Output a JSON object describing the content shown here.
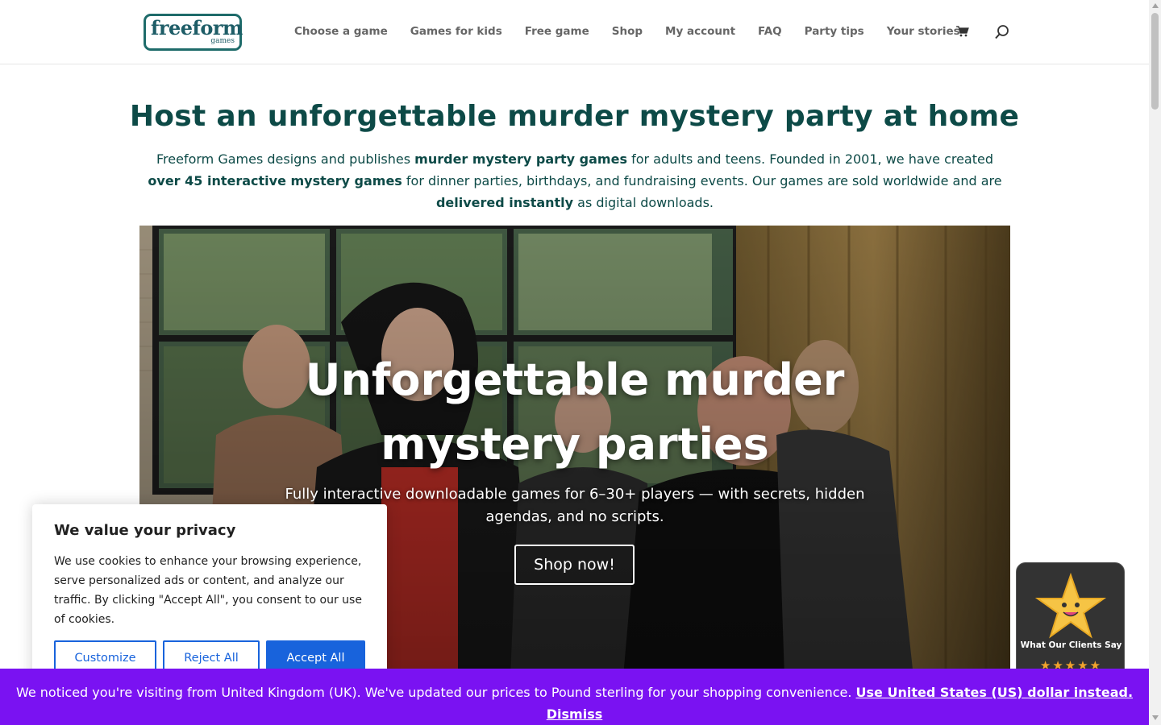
{
  "header": {
    "logo_main": "freeform",
    "logo_sub": "games",
    "nav": [
      "Choose a game",
      "Games for kids",
      "Free game",
      "Shop",
      "My account",
      "FAQ",
      "Party tips",
      "Your stories"
    ],
    "cart_icon": "shopping-cart-icon",
    "search_icon": "search-icon"
  },
  "intro": {
    "title": "Host an unforgettable murder mystery party at home",
    "p1": "Freeform Games designs and publishes ",
    "b1": "murder mystery party games",
    "p2": " for adults and teens. Founded in 2001, we have created ",
    "b2": "over 45 interactive mystery games",
    "p3": " for dinner parties, birthdays, and fundraising events. Our games are sold worldwide and are ",
    "b3": "delivered instantly",
    "p4": " as digital downloads."
  },
  "hero": {
    "title": "Unforgettable murder mystery parties",
    "subtitle": "Fully interactive downloadable games for 6–30+ players — with secrets, hidden agendas, and no scripts.",
    "button": "Shop now!"
  },
  "cookie": {
    "title": "We value your privacy",
    "text": "We use cookies to enhance your browsing experience, serve personalized ads or content, and analyze our traffic. By clicking \"Accept All\", you consent to our use of cookies.",
    "customize": "Customize",
    "reject": "Reject All",
    "accept": "Accept All"
  },
  "reviews": {
    "label": "What Our Clients Say",
    "stars": "★★★★★",
    "rating": 4.5,
    "icon": "smiling-star-icon"
  },
  "currency_bar": {
    "text": "We noticed you're visiting from United Kingdom (UK). We've updated our prices to Pound sterling for your shopping convenience. ",
    "link": "Use United States (US) dollar instead.",
    "dismiss": "Dismiss"
  },
  "colors": {
    "brand_teal": "#0d4a47",
    "cookie_blue": "#1863dc",
    "currency_purple": "#7a12f2",
    "star_gold": "#f2a32c"
  }
}
